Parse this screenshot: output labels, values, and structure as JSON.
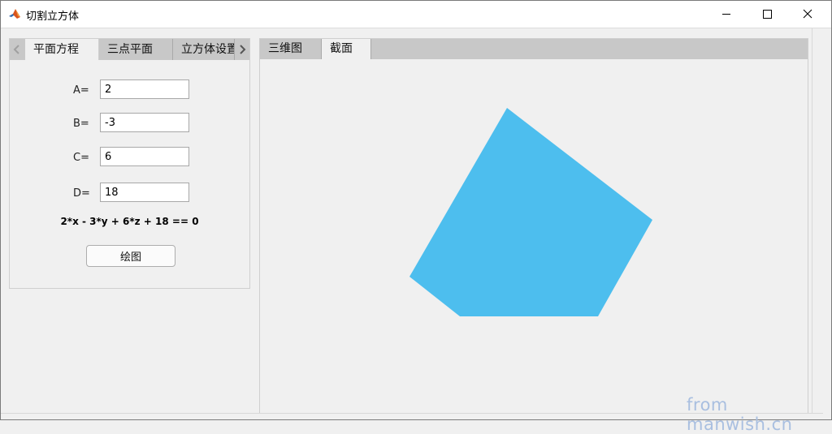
{
  "window": {
    "title": "切割立方体",
    "controls": {
      "minimize": "minimize-icon",
      "maximize": "maximize-icon",
      "close": "close-icon"
    }
  },
  "left_tabs": {
    "items": [
      {
        "label": "平面方程",
        "active": true
      },
      {
        "label": "三点平面",
        "active": false
      },
      {
        "label": "立方体设置",
        "active": false
      }
    ]
  },
  "plane_form": {
    "fields": [
      {
        "label": "A=",
        "value": "2"
      },
      {
        "label": "B=",
        "value": "-3"
      },
      {
        "label": "C=",
        "value": "6"
      },
      {
        "label": "D=",
        "value": "18"
      }
    ],
    "equation": "2*x - 3*y + 6*z + 18 == 0",
    "plot_button": "绘图"
  },
  "right_tabs": {
    "items": [
      {
        "label": "三维图",
        "active": false
      },
      {
        "label": "截面",
        "active": true
      }
    ]
  },
  "section_shape": {
    "color": "#4dbeee"
  },
  "watermark": "from manwish.cn"
}
